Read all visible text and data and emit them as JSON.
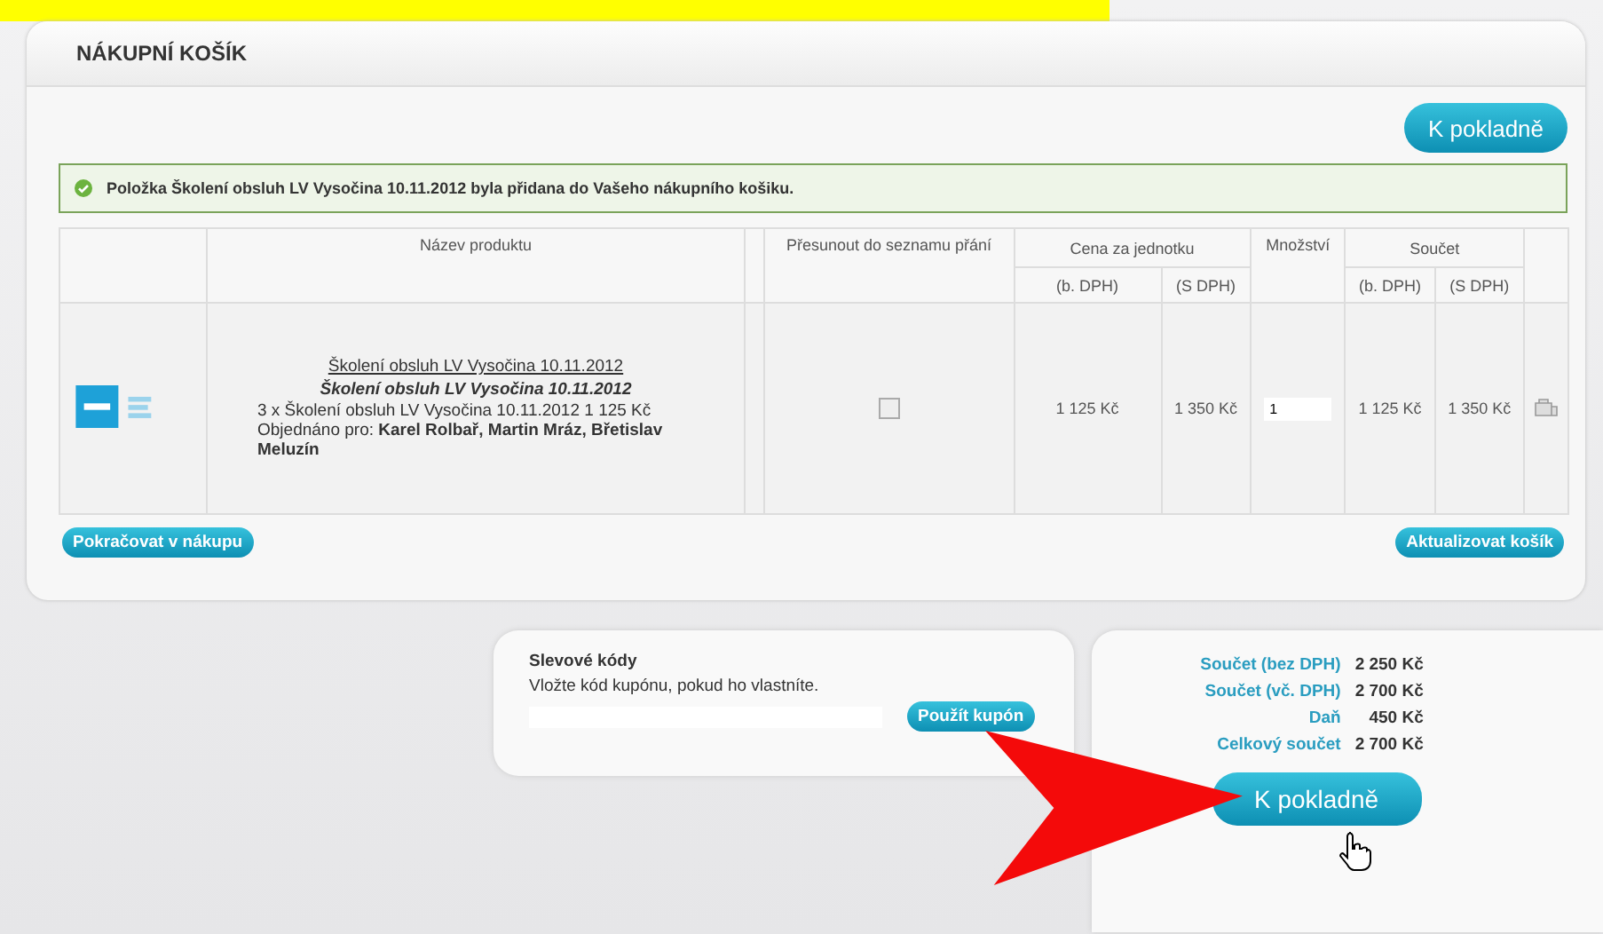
{
  "panel": {
    "title": "NÁKUPNÍ KOŠÍK",
    "checkout_button": "K pokladně"
  },
  "message": {
    "kind": "success",
    "text": "Položka Školení obsluh LV Vysočina 10.11.2012 byla přidana do Vašeho nákupního košiku."
  },
  "table": {
    "columns": [
      "Název produktu",
      "Přesunout do seznamu přání",
      "Cena za jednotku",
      "Množství",
      "Součet"
    ],
    "subcolumns": [
      "(b. DPH)",
      "(S DPH)",
      "(b. DPH)",
      "(S DPH)"
    ],
    "rows": [
      {
        "link": "Školení obsluh LV Vysočina 10.11.2012",
        "title": "Školení obsluh LV Vysočina 10.11.2012",
        "detail": "3 x Školení obsluh LV Vysočina 10.11.2012 1 125 Kč",
        "ordered_label": "Objednáno pro:",
        "ordered_for": "Karel Rolbař, Martin Mráz, Břetislav Meluzín",
        "wishlist_checked": false,
        "unit_net": "1 125 Kč",
        "unit_gross": "1 350 Kč",
        "quantity": "1",
        "total_net": "1 125 Kč",
        "total_gross": "1 350 Kč"
      }
    ]
  },
  "continue_button": "Pokračovat v nákupu",
  "update_button": "Aktualizovat košík",
  "coupon": {
    "title": "Slevové kódy",
    "hint": "Vložte kód kupónu, pokud ho vlastníte.",
    "button": "Použít kupón"
  },
  "totals": [
    {
      "label": "Součet (bez DPH)",
      "value": "2 250 Kč"
    },
    {
      "label": "Součet (vč. DPH)",
      "value": "2 700 Kč"
    },
    {
      "label": "Daň",
      "value": "450 Kč"
    },
    {
      "label": "Celkový součet",
      "value": "2 700 Kč"
    }
  ],
  "checkout_button": "K pokladně"
}
